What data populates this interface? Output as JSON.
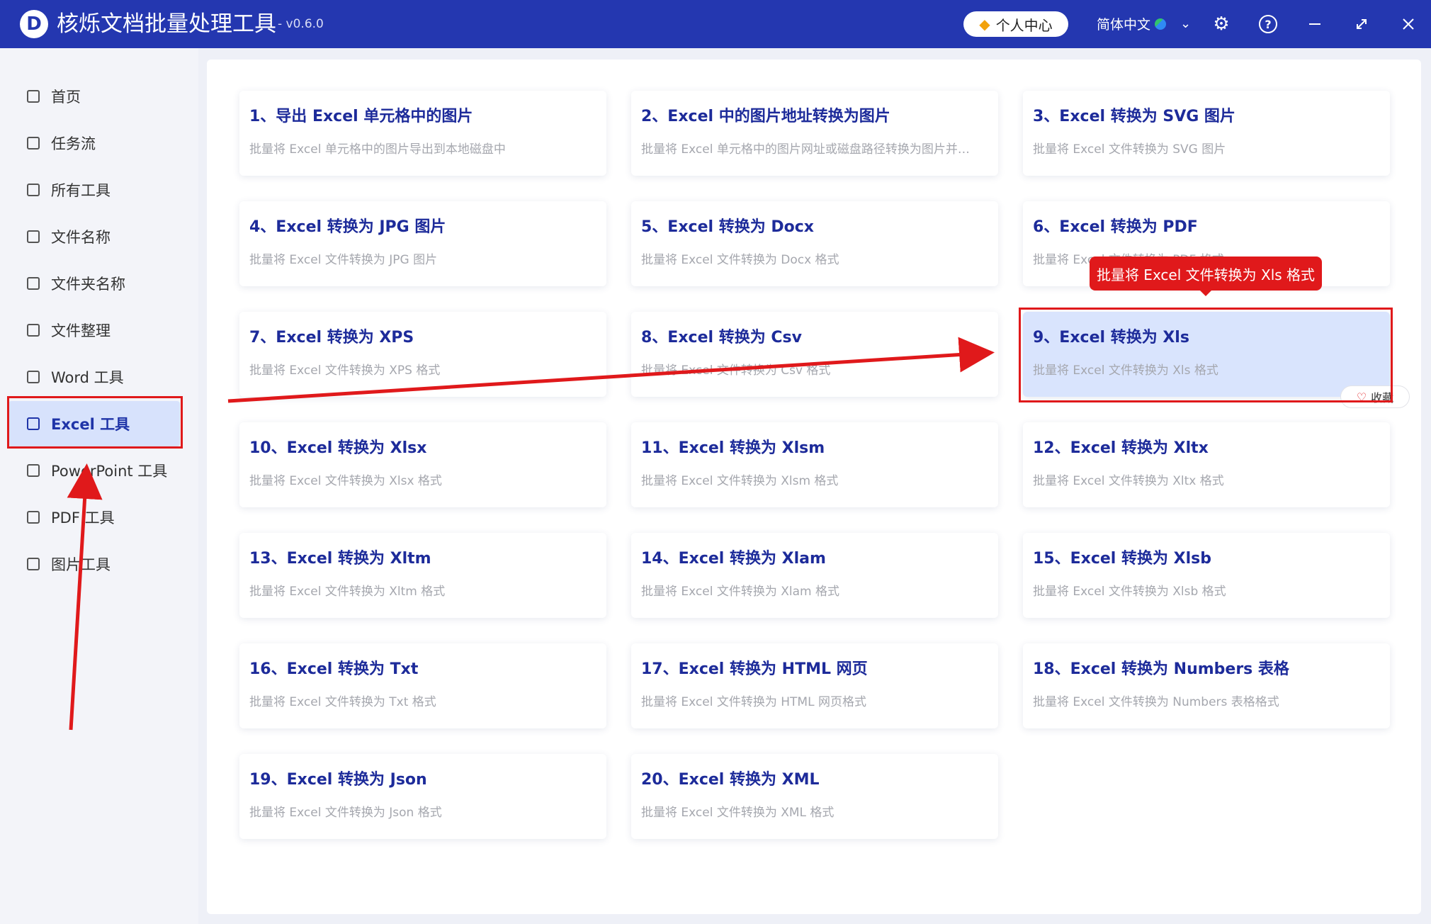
{
  "titlebar": {
    "logo_letter": "D",
    "title": "核烁文档批量处理工具",
    "version": "- v0.6.0",
    "vip_label": "个人中心",
    "language": "简体中文",
    "icons": [
      "vip-diamond-icon",
      "globe-icon",
      "chevron-down-icon",
      "gear-icon",
      "help-icon",
      "minimize-icon",
      "maximize-icon",
      "close-icon"
    ]
  },
  "sidebar": {
    "items": [
      {
        "label": "首页",
        "icon": "home-icon"
      },
      {
        "label": "任务流",
        "icon": "workflow-icon"
      },
      {
        "label": "所有工具",
        "icon": "monitor-icon"
      },
      {
        "label": "文件名称",
        "icon": "file-name-icon"
      },
      {
        "label": "文件夹名称",
        "icon": "folder-icon"
      },
      {
        "label": "文件整理",
        "icon": "organize-icon"
      },
      {
        "label": "Word 工具",
        "icon": "word-icon"
      },
      {
        "label": "Excel 工具",
        "icon": "excel-icon"
      },
      {
        "label": "PowerPoint 工具",
        "icon": "powerpoint-icon"
      },
      {
        "label": "PDF 工具",
        "icon": "pdf-icon"
      },
      {
        "label": "图片工具",
        "icon": "image-icon"
      }
    ],
    "active_index": 7
  },
  "tools": [
    {
      "title": "1、导出 Excel 单元格中的图片",
      "desc": "批量将 Excel 单元格中的图片导出到本地磁盘中"
    },
    {
      "title": "2、Excel 中的图片地址转换为图片",
      "desc": "批量将 Excel 单元格中的图片网址或磁盘路径转换为图片并…"
    },
    {
      "title": "3、Excel 转换为 SVG 图片",
      "desc": "批量将 Excel 文件转换为 SVG 图片"
    },
    {
      "title": "4、Excel 转换为 JPG 图片",
      "desc": "批量将 Excel 文件转换为 JPG 图片"
    },
    {
      "title": "5、Excel 转换为 Docx",
      "desc": "批量将 Excel 文件转换为 Docx 格式"
    },
    {
      "title": "6、Excel 转换为 PDF",
      "desc": "批量将 Excel 文件转换为 PDF 格式"
    },
    {
      "title": "7、Excel 转换为 XPS",
      "desc": "批量将 Excel 文件转换为 XPS 格式"
    },
    {
      "title": "8、Excel 转换为 Csv",
      "desc": "批量将 Excel 文件转换为 Csv 格式"
    },
    {
      "title": "9、Excel 转换为 Xls",
      "desc": "批量将 Excel 文件转换为 Xls 格式"
    },
    {
      "title": "10、Excel 转换为 Xlsx",
      "desc": "批量将 Excel 文件转换为 Xlsx 格式"
    },
    {
      "title": "11、Excel 转换为 Xlsm",
      "desc": "批量将 Excel 文件转换为 Xlsm 格式"
    },
    {
      "title": "12、Excel 转换为 Xltx",
      "desc": "批量将 Excel 文件转换为 Xltx 格式"
    },
    {
      "title": "13、Excel 转换为 Xltm",
      "desc": "批量将 Excel 文件转换为 Xltm 格式"
    },
    {
      "title": "14、Excel 转换为 Xlam",
      "desc": "批量将 Excel 文件转换为 Xlam 格式"
    },
    {
      "title": "15、Excel 转换为 Xlsb",
      "desc": "批量将 Excel 文件转换为 Xlsb 格式"
    },
    {
      "title": "16、Excel 转换为 Txt",
      "desc": "批量将 Excel 文件转换为 Txt 格式"
    },
    {
      "title": "17、Excel 转换为 HTML 网页",
      "desc": "批量将 Excel 文件转换为 HTML 网页格式"
    },
    {
      "title": "18、Excel 转换为 Numbers 表格",
      "desc": "批量将 Excel 文件转换为 Numbers 表格格式"
    },
    {
      "title": "19、Excel 转换为 Json",
      "desc": "批量将 Excel 文件转换为 Json 格式"
    },
    {
      "title": "20、Excel 转换为 XML",
      "desc": "批量将 Excel 文件转换为 XML 格式"
    }
  ],
  "selected_tool_index": 8,
  "tooltip": {
    "text": "批量将 Excel 文件转换为 Xls 格式"
  },
  "favorite_label": "收藏",
  "annotation_color": "#e0191b",
  "accent_color": "#2437b0"
}
